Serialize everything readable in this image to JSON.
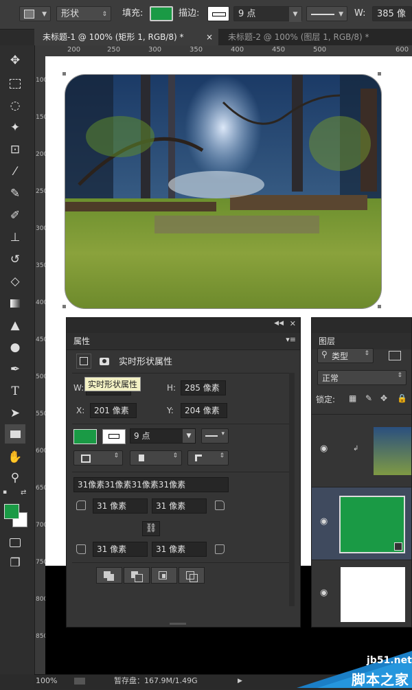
{
  "options_bar": {
    "shape_mode": "形状",
    "fill_label": "填充:",
    "fill_color": "#1a9a45",
    "stroke_label": "描边:",
    "stroke_width": "9 点",
    "width_label": "W:",
    "width_value": "385 像"
  },
  "tabs": [
    {
      "label": "未标题-1 @ 100% (矩形 1, RGB/8) *",
      "close": "×"
    },
    {
      "label": "未标题-2 @ 100% (图层 1, RGB/8) *",
      "close": "×"
    }
  ],
  "ruler_h": [
    "200",
    "250",
    "300",
    "350",
    "400",
    "450",
    "500",
    "600"
  ],
  "ruler_v": [
    "100",
    "150",
    "200",
    "250",
    "300",
    "350",
    "400",
    "450",
    "500",
    "550",
    "600",
    "650",
    "700",
    "750",
    "800",
    "850"
  ],
  "properties": {
    "title": "属性",
    "header": "实时形状属性",
    "tooltip": "实时形状属性",
    "w_label": "W:",
    "h_label": "H:",
    "h_value": "285 像素",
    "x_label": "X:",
    "x_value": "201 像素",
    "y_label": "Y:",
    "y_value": "204 像素",
    "stroke_width": "9 点",
    "corner_all": "31像素31像素31像素31像素",
    "corner_tl": "31 像素",
    "corner_tr": "31 像素",
    "corner_bl": "31 像素",
    "corner_br": "31 像素"
  },
  "layers": {
    "title": "图层",
    "filter": "类型",
    "blend": "正常",
    "lock": "锁定:"
  },
  "status": {
    "zoom": "100%",
    "scratch": "暂存盘：167.9M/1.49G"
  },
  "watermark": {
    "site": "jb51.net",
    "name": "脚本之家"
  },
  "colors": {
    "foreground": "#1a9a45",
    "background": "#ffffff"
  }
}
